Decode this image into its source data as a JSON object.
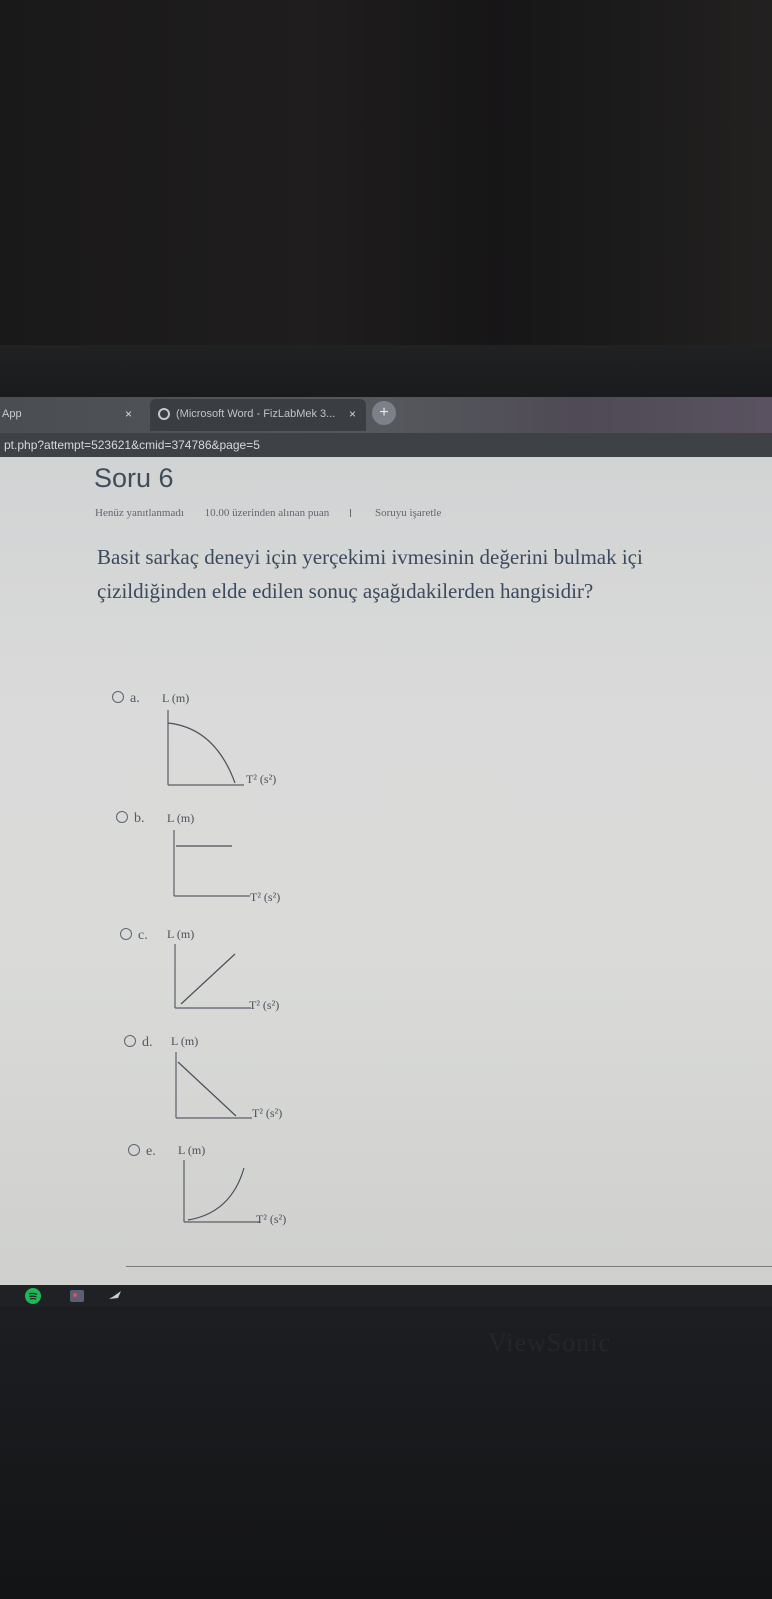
{
  "browser": {
    "tabs": [
      {
        "label": "App",
        "close": "×"
      },
      {
        "label": "(Microsoft Word - FizLabMek 3...",
        "close": "×"
      }
    ],
    "new_tab": "+",
    "url": "pt.php?attempt=523621&cmid=374786&page=5"
  },
  "question": {
    "title": "Soru 6",
    "status": "Henüz yanıtlanmadı",
    "points": "10.00 üzerinden alınan puan",
    "flag_label": "Soruyu işaretle",
    "text_line1": "Basit sarkaç deneyi için yerçekimi ivmesinin değerini bulmak içi",
    "text_line2": "çizildiğinden elde edilen sonuç aşağıdakilerden hangisidir?"
  },
  "options": [
    {
      "letter": "a.",
      "ylabel": "L (m)",
      "xlabel": "T² (s²)",
      "curve": "decreasing-concave"
    },
    {
      "letter": "b.",
      "ylabel": "L (m)",
      "xlabel": "T² (s²)",
      "curve": "horizontal-constant"
    },
    {
      "letter": "c.",
      "ylabel": "L (m)",
      "xlabel": "T² (s²)",
      "curve": "increasing-linear"
    },
    {
      "letter": "d.",
      "ylabel": "L (m)",
      "xlabel": "T² (s²)",
      "curve": "decreasing-linear"
    },
    {
      "letter": "e.",
      "ylabel": "L (m)",
      "xlabel": "T² (s²)",
      "curve": "increasing-concave"
    }
  ],
  "monitor": {
    "brand": "ViewSonic"
  },
  "colors": {
    "page_bg": "#d8d9d7",
    "heading": "#3e4d5e",
    "tab_bar": "#4f5257"
  }
}
